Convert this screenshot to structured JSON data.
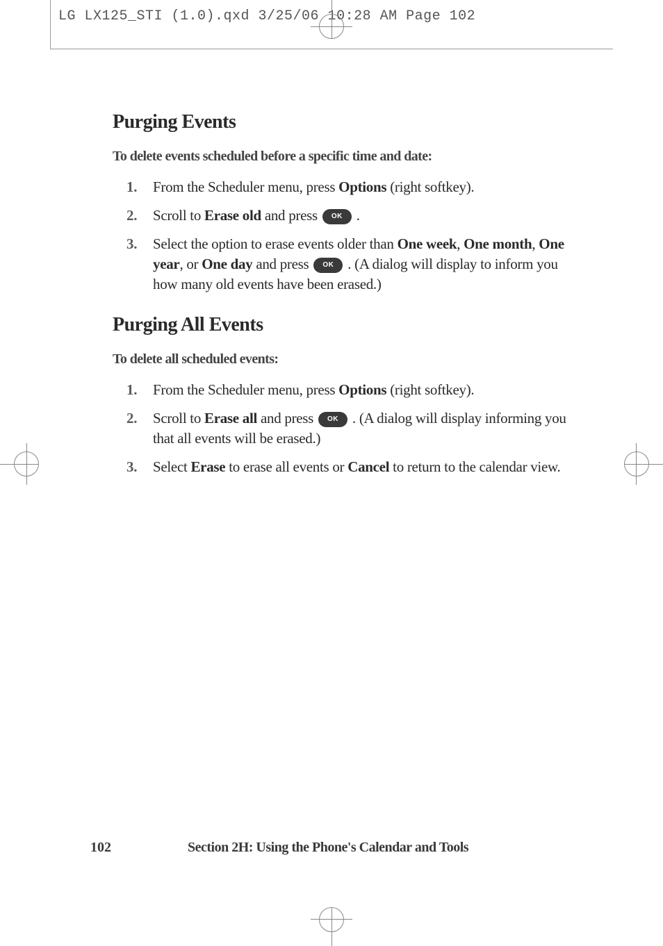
{
  "print_header": "LG LX125_STI (1.0).qxd  3/25/06  10:28 AM  Page 102",
  "section1": {
    "heading": "Purging Events",
    "intro": "To delete events scheduled before a specific time and date:",
    "steps": [
      {
        "num": "1.",
        "pre": "From the Scheduler menu, press ",
        "bold1": "Options",
        "post1": " (right softkey)."
      },
      {
        "num": "2.",
        "pre": "Scroll to ",
        "bold1": "Erase old",
        "mid": " and press ",
        "has_ok": true,
        "post": " ."
      },
      {
        "num": "3.",
        "pre": "Select the option to erase events older than ",
        "bold1": "One week",
        "mid1": ", ",
        "bold2": "One month",
        "mid2": ", ",
        "bold3": "One year",
        "mid3": ", or ",
        "bold4": "One day",
        "mid4": " and press ",
        "has_ok": true,
        "post": " . (A dialog will display to inform you how many old events have been erased.)"
      }
    ]
  },
  "section2": {
    "heading": "Purging All Events",
    "intro": "To delete all scheduled events:",
    "steps": [
      {
        "num": "1.",
        "pre": "From the Scheduler menu, press ",
        "bold1": "Options",
        "post1": " (right softkey)."
      },
      {
        "num": "2.",
        "pre": "Scroll to ",
        "bold1": "Erase all",
        "mid": " and press ",
        "has_ok": true,
        "post": " . (A dialog will display informing you that all events will be erased.)"
      },
      {
        "num": "3.",
        "pre": "Select ",
        "bold1": "Erase",
        "mid1": " to erase all events or ",
        "bold2": "Cancel",
        "post": " to return to the calendar view."
      }
    ]
  },
  "footer": {
    "page_num": "102",
    "section": "Section 2H: Using the Phone's Calendar and Tools"
  }
}
